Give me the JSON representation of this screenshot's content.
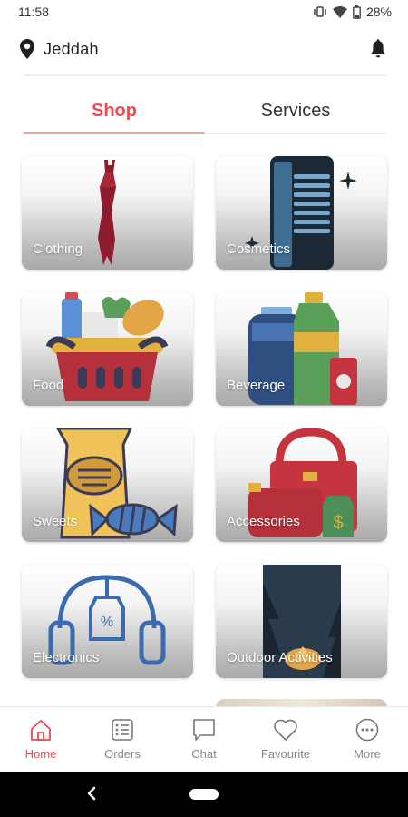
{
  "status_bar": {
    "time": "11:58",
    "battery": "28%"
  },
  "header": {
    "location": "Jeddah"
  },
  "tabs": [
    {
      "label": "Shop",
      "active": true
    },
    {
      "label": "Services",
      "active": false
    }
  ],
  "categories": [
    {
      "label": "Clothing",
      "icon": "dress-icon"
    },
    {
      "label": "Cosmetics",
      "icon": "comb-icon"
    },
    {
      "label": "Food",
      "icon": "grocery-basket-icon"
    },
    {
      "label": "Beverage",
      "icon": "bottles-icon"
    },
    {
      "label": "Sweets",
      "icon": "candy-bag-icon"
    },
    {
      "label": "Accessories",
      "icon": "handbag-icon"
    },
    {
      "label": "Electronics",
      "icon": "headphones-icon"
    },
    {
      "label": "Outdoor Activities",
      "icon": "camping-photo"
    }
  ],
  "bottom_nav": [
    {
      "label": "Home",
      "icon": "home-icon",
      "active": true
    },
    {
      "label": "Orders",
      "icon": "orders-icon",
      "active": false
    },
    {
      "label": "Chat",
      "icon": "chat-icon",
      "active": false
    },
    {
      "label": "Favourite",
      "icon": "heart-icon",
      "active": false
    },
    {
      "label": "More",
      "icon": "more-icon",
      "active": false
    }
  ],
  "colors": {
    "accent": "#ef4a4f",
    "inactive": "#888888"
  }
}
